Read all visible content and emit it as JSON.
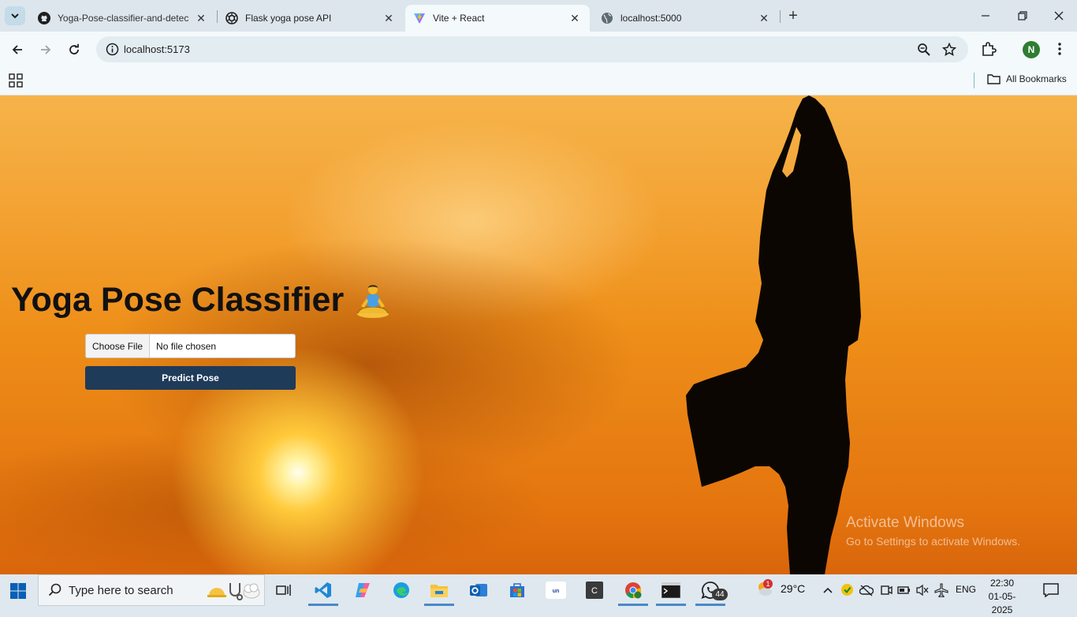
{
  "browser": {
    "tabs": [
      {
        "title": "Yoga-Pose-classifier-and-detec",
        "favicon": "github-icon",
        "active": false
      },
      {
        "title": "Flask yoga pose API",
        "favicon": "openai-icon",
        "active": false
      },
      {
        "title": "Vite + React",
        "favicon": "vite-icon",
        "active": true
      },
      {
        "title": "localhost:5000",
        "favicon": "globe-icon",
        "active": false
      }
    ],
    "address": "localhost:5173",
    "profile_initial": "N",
    "bookmarks": {
      "all_label": "All Bookmarks"
    }
  },
  "page": {
    "title": "Yoga Pose Classifier",
    "title_icon": "person-in-lotus-position-icon",
    "file_input": {
      "button_label": "Choose File",
      "status": "No file chosen"
    },
    "predict_label": "Predict Pose",
    "watermark": {
      "title": "Activate Windows",
      "subtitle": "Go to Settings to activate Windows."
    }
  },
  "taskbar": {
    "search_placeholder": "Type here to search",
    "weather": {
      "temp": "29°C",
      "badge": "1"
    },
    "whatsapp_badge": "44",
    "language": "ENG",
    "time": "22:30",
    "date": "01-05-2025"
  },
  "colors": {
    "predict_button": "#1f3b5a",
    "active_tab": "#f4f9fb",
    "tabstrip": "#dde6ec"
  }
}
